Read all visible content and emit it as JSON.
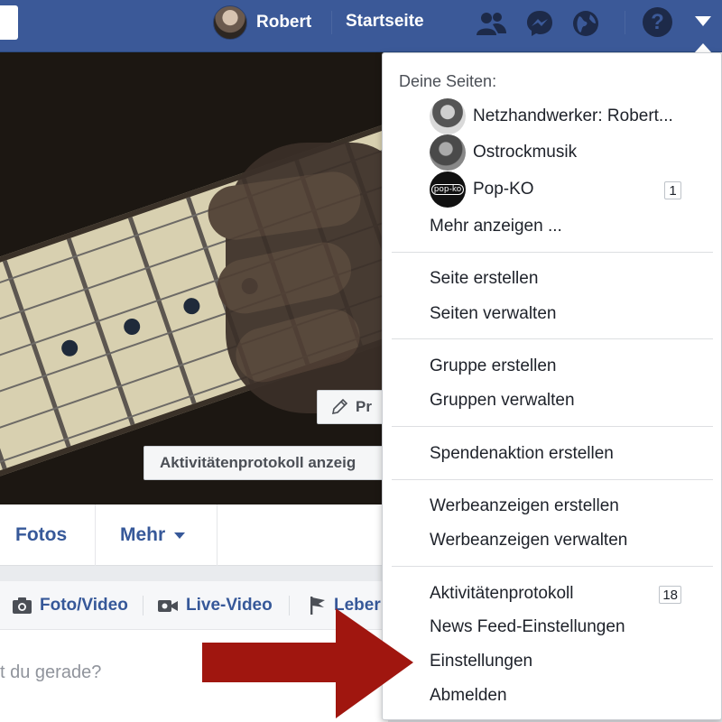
{
  "header": {
    "profile_name": "Robert",
    "home_label": "Startseite",
    "icons": [
      "friends-icon",
      "messenger-icon",
      "notifications-globe-icon",
      "help-icon",
      "account-menu-caret-icon"
    ],
    "bar_color": "#3b5998"
  },
  "cover": {
    "edit_profile_label": "Pr",
    "activity_log_button": "Aktivitätenprotokoll anzeig"
  },
  "profile_nav": {
    "tabs": [
      {
        "label": "Fotos"
      },
      {
        "label": "Mehr"
      }
    ]
  },
  "composer": {
    "actions": [
      {
        "label": "Foto/Video",
        "icon": "camera-icon"
      },
      {
        "label": "Live-Video",
        "icon": "video-camera-icon"
      },
      {
        "label": "Leber",
        "icon": "flag-icon"
      }
    ],
    "placeholder": "t du gerade?"
  },
  "dropdown": {
    "pages_header": "Deine Seiten:",
    "pages": [
      {
        "name": "Netzhandwerker: Robert..."
      },
      {
        "name": "Ostrockmusik"
      },
      {
        "name": "Pop-KO",
        "badge": "1",
        "logo_text": "pop-ko"
      }
    ],
    "more_label": "Mehr anzeigen ...",
    "sections": [
      [
        "Seite erstellen",
        "Seiten verwalten"
      ],
      [
        "Gruppe erstellen",
        "Gruppen verwalten"
      ],
      [
        "Spendenaktion erstellen"
      ],
      [
        "Werbeanzeigen erstellen",
        "Werbeanzeigen verwalten"
      ],
      [
        "Aktivitätenprotokoll",
        "News Feed-Einstellungen",
        "Einstellungen",
        "Abmelden"
      ]
    ],
    "activity_badge": "18"
  },
  "annotation": {
    "arrow_color": "#a0160f",
    "points_to": "Einstellungen"
  }
}
